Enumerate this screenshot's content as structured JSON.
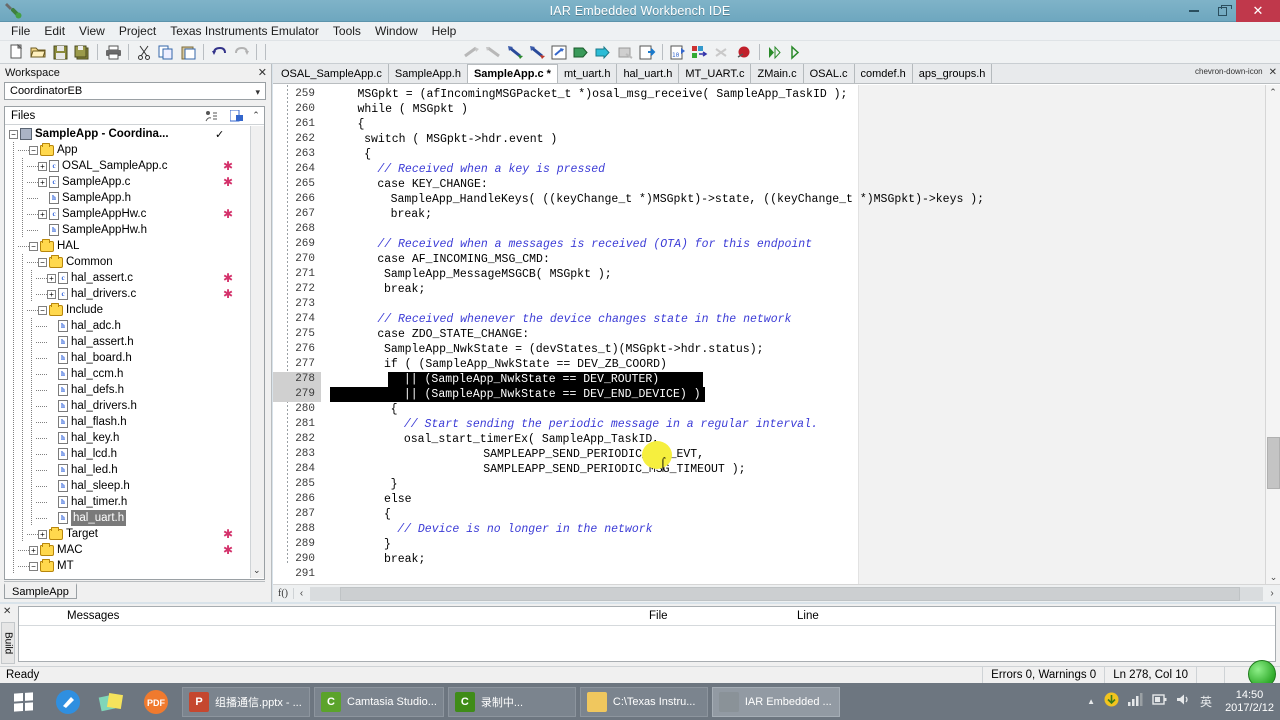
{
  "window": {
    "title": "IAR Embedded Workbench IDE",
    "app_icon": "wrench-screwdriver-icon",
    "minimize_label": "–",
    "restore_label": "❐",
    "close_label": "✕"
  },
  "menu": [
    {
      "label": "File"
    },
    {
      "label": "Edit"
    },
    {
      "label": "View"
    },
    {
      "label": "Project"
    },
    {
      "label": "Texas Instruments Emulator"
    },
    {
      "label": "Tools"
    },
    {
      "label": "Window"
    },
    {
      "label": "Help"
    }
  ],
  "toolbar": [
    {
      "name": "new-document-icon"
    },
    {
      "name": "open-folder-icon"
    },
    {
      "name": "save-icon"
    },
    {
      "name": "save-all-icon"
    },
    {
      "name": "print-icon"
    },
    {
      "name": "cut-icon"
    },
    {
      "name": "copy-icon"
    },
    {
      "name": "paste-icon"
    },
    {
      "name": "undo-icon"
    },
    {
      "name": "redo-icon"
    },
    {
      "name": "bookmark-toggle-icon"
    },
    {
      "name": "bookmark-next-icon"
    },
    {
      "name": "navigate-forward-icon"
    },
    {
      "name": "navigate-backward-icon"
    },
    {
      "name": "find-in-files-icon"
    },
    {
      "name": "compile-icon"
    },
    {
      "name": "make-icon"
    },
    {
      "name": "stop-build-icon"
    },
    {
      "name": "debug-download-icon"
    },
    {
      "name": "header-source-icon"
    },
    {
      "name": "go-to-definition-icon"
    },
    {
      "name": "toggle-breakpoints-icon"
    },
    {
      "name": "breakpoint-icon"
    },
    {
      "name": "run-icon"
    },
    {
      "name": "run-to-cursor-icon"
    }
  ],
  "workspace": {
    "panel_title": "Workspace",
    "close_label": "✕",
    "configuration": "CoordinatorEB",
    "combo_arrow": "chevron-down-icon",
    "files_header": "Files",
    "scroll_up": "⌃",
    "scroll_down": "⌄",
    "tab_label": "SampleApp",
    "tree": [
      {
        "label": "SampleApp - Coordina...",
        "depth": 0,
        "type": "project",
        "expander": "minus",
        "bold": true,
        "check": true,
        "star": false
      },
      {
        "label": "App",
        "depth": 1,
        "type": "folder",
        "expander": "minus",
        "star": false
      },
      {
        "label": "OSAL_SampleApp.c",
        "depth": 2,
        "type": "c",
        "expander": "plus",
        "star": true
      },
      {
        "label": "SampleApp.c",
        "depth": 2,
        "type": "c",
        "expander": "plus",
        "star": true
      },
      {
        "label": "SampleApp.h",
        "depth": 2,
        "type": "h",
        "expander": "none",
        "star": false
      },
      {
        "label": "SampleAppHw.c",
        "depth": 2,
        "type": "c",
        "expander": "plus",
        "star": true
      },
      {
        "label": "SampleAppHw.h",
        "depth": 2,
        "type": "h",
        "expander": "none",
        "star": false
      },
      {
        "label": "HAL",
        "depth": 1,
        "type": "folder",
        "expander": "minus",
        "star": false
      },
      {
        "label": "Common",
        "depth": 2,
        "type": "folder",
        "expander": "minus",
        "star": false
      },
      {
        "label": "hal_assert.c",
        "depth": 3,
        "type": "c",
        "expander": "plus",
        "star": true
      },
      {
        "label": "hal_drivers.c",
        "depth": 3,
        "type": "c",
        "expander": "plus",
        "star": true
      },
      {
        "label": "Include",
        "depth": 2,
        "type": "folder",
        "expander": "minus",
        "star": false
      },
      {
        "label": "hal_adc.h",
        "depth": 3,
        "type": "h",
        "expander": "none",
        "star": false
      },
      {
        "label": "hal_assert.h",
        "depth": 3,
        "type": "h",
        "expander": "none",
        "star": false
      },
      {
        "label": "hal_board.h",
        "depth": 3,
        "type": "h",
        "expander": "none",
        "star": false
      },
      {
        "label": "hal_ccm.h",
        "depth": 3,
        "type": "h",
        "expander": "none",
        "star": false
      },
      {
        "label": "hal_defs.h",
        "depth": 3,
        "type": "h",
        "expander": "none",
        "star": false
      },
      {
        "label": "hal_drivers.h",
        "depth": 3,
        "type": "h",
        "expander": "none",
        "star": false
      },
      {
        "label": "hal_flash.h",
        "depth": 3,
        "type": "h",
        "expander": "none",
        "star": false
      },
      {
        "label": "hal_key.h",
        "depth": 3,
        "type": "h",
        "expander": "none",
        "star": false
      },
      {
        "label": "hal_lcd.h",
        "depth": 3,
        "type": "h",
        "expander": "none",
        "star": false
      },
      {
        "label": "hal_led.h",
        "depth": 3,
        "type": "h",
        "expander": "none",
        "star": false
      },
      {
        "label": "hal_sleep.h",
        "depth": 3,
        "type": "h",
        "expander": "none",
        "star": false
      },
      {
        "label": "hal_timer.h",
        "depth": 3,
        "type": "h",
        "expander": "none",
        "star": false
      },
      {
        "label": "hal_uart.h",
        "depth": 3,
        "type": "h",
        "expander": "none",
        "star": false,
        "selected": true
      },
      {
        "label": "Target",
        "depth": 2,
        "type": "folder",
        "expander": "plus",
        "star": true
      },
      {
        "label": "MAC",
        "depth": 1,
        "type": "folder",
        "expander": "plus",
        "star": true
      },
      {
        "label": "MT",
        "depth": 1,
        "type": "folder",
        "expander": "minus",
        "star": false
      }
    ]
  },
  "editor": {
    "tabs": [
      {
        "label": "OSAL_SampleApp.c",
        "active": false
      },
      {
        "label": "SampleApp.h",
        "active": false
      },
      {
        "label": "SampleApp.c *",
        "active": true
      },
      {
        "label": "mt_uart.h",
        "active": false
      },
      {
        "label": "hal_uart.h",
        "active": false
      },
      {
        "label": "MT_UART.c",
        "active": false
      },
      {
        "label": "ZMain.c",
        "active": false
      },
      {
        "label": "OSAL.c",
        "active": false
      },
      {
        "label": "comdef.h",
        "active": false
      },
      {
        "label": "aps_groups.h",
        "active": false
      }
    ],
    "tab_menu_icon": "chevron-down-icon",
    "tab_close_icon": "close-icon",
    "function_label": "f()",
    "hscroll_left": "‹",
    "hscroll_right": "›",
    "vscroll_up": "⌃",
    "vscroll_down": "⌄",
    "lines": [
      {
        "no": 259,
        "indent": 4,
        "text": "MSGpkt = (afIncomingMSGPacket_t *)osal_msg_receive( SampleApp_TaskID );",
        "kind": "code"
      },
      {
        "no": 260,
        "indent": 4,
        "text": "while ( MSGpkt )",
        "kind": "code"
      },
      {
        "no": 261,
        "indent": 4,
        "text": "{",
        "kind": "code"
      },
      {
        "no": 262,
        "indent": 5,
        "text": "switch ( MSGpkt->hdr.event )",
        "kind": "code"
      },
      {
        "no": 263,
        "indent": 5,
        "text": "{",
        "kind": "code"
      },
      {
        "no": 264,
        "indent": 7,
        "text": "// Received when a key is pressed",
        "kind": "comment"
      },
      {
        "no": 265,
        "indent": 7,
        "text": "case KEY_CHANGE:",
        "kind": "code"
      },
      {
        "no": 266,
        "indent": 9,
        "text": "SampleApp_HandleKeys( ((keyChange_t *)MSGpkt)->state, ((keyChange_t *)MSGpkt)->keys );",
        "kind": "code"
      },
      {
        "no": 267,
        "indent": 9,
        "text": "break;",
        "kind": "code"
      },
      {
        "no": 268,
        "indent": 0,
        "text": "",
        "kind": "code"
      },
      {
        "no": 269,
        "indent": 7,
        "text": "// Received when a messages is received (OTA) for this endpoint",
        "kind": "comment"
      },
      {
        "no": 270,
        "indent": 7,
        "text": "case AF_INCOMING_MSG_CMD:",
        "kind": "code"
      },
      {
        "no": 271,
        "indent": 8,
        "text": "SampleApp_MessageMSGCB( MSGpkt );",
        "kind": "code"
      },
      {
        "no": 272,
        "indent": 8,
        "text": "break;",
        "kind": "code"
      },
      {
        "no": 273,
        "indent": 0,
        "text": "",
        "kind": "code"
      },
      {
        "no": 274,
        "indent": 7,
        "text": "// Received whenever the device changes state in the network",
        "kind": "comment"
      },
      {
        "no": 275,
        "indent": 7,
        "text": "case ZDO_STATE_CHANGE:",
        "kind": "code"
      },
      {
        "no": 276,
        "indent": 8,
        "text": "SampleApp_NwkState = (devStates_t)(MSGpkt->hdr.status);",
        "kind": "code"
      },
      {
        "no": 277,
        "indent": 8,
        "text": "if ( (SampleApp_NwkState == DEV_ZB_COORD)",
        "kind": "code"
      },
      {
        "no": 278,
        "indent": 11,
        "text": "|| (SampleApp_NwkState == DEV_ROUTER)",
        "kind": "selected"
      },
      {
        "no": 279,
        "indent": 11,
        "text": "|| (SampleApp_NwkState == DEV_END_DEVICE) )",
        "kind": "selected"
      },
      {
        "no": 280,
        "indent": 9,
        "text": "{",
        "kind": "code"
      },
      {
        "no": 281,
        "indent": 11,
        "text": "// Start sending the periodic message in a regular interval.",
        "kind": "comment"
      },
      {
        "no": 282,
        "indent": 11,
        "text": "osal_start_timerEx( SampleApp_TaskID,",
        "kind": "code"
      },
      {
        "no": 283,
        "indent": 23,
        "text": "SAMPLEAPP_SEND_PERIODIC_MSG_EVT,",
        "kind": "code"
      },
      {
        "no": 284,
        "indent": 23,
        "text": "SAMPLEAPP_SEND_PERIODIC_MSG_TIMEOUT );",
        "kind": "code"
      },
      {
        "no": 285,
        "indent": 9,
        "text": "}",
        "kind": "code"
      },
      {
        "no": 286,
        "indent": 8,
        "text": "else",
        "kind": "code"
      },
      {
        "no": 287,
        "indent": 8,
        "text": "{",
        "kind": "code"
      },
      {
        "no": 288,
        "indent": 10,
        "text": "// Device is no longer in the network",
        "kind": "comment"
      },
      {
        "no": 289,
        "indent": 8,
        "text": "}",
        "kind": "code"
      },
      {
        "no": 290,
        "indent": 8,
        "text": "break;",
        "kind": "code"
      },
      {
        "no": 291,
        "indent": 0,
        "text": "",
        "kind": "code"
      }
    ]
  },
  "build_panel": {
    "close_label": "✕",
    "tab_label": "Build",
    "columns": [
      {
        "label": "Messages"
      },
      {
        "label": "File"
      },
      {
        "label": "Line"
      }
    ]
  },
  "status_bar": {
    "ready": "Ready",
    "errors_warnings": "Errors 0, Warnings 0",
    "cursor_position": "Ln 278, Col 10"
  },
  "taskbar": {
    "start_label": "windows-logo",
    "quick_launch": [
      {
        "name": "blue-circle-pen-icon"
      },
      {
        "name": "sticky-notes-icon"
      },
      {
        "name": "pdf-icon",
        "label": "PDF"
      }
    ],
    "apps": [
      {
        "label": "组播通信.pptx - ...",
        "icon": "powerpoint-icon",
        "icon_letter": "P",
        "icon_color": "#c5472f",
        "active": false
      },
      {
        "label": "Camtasia Studio...",
        "icon": "camtasia-icon",
        "icon_letter": "C",
        "icon_color": "#5ba32b",
        "active": false
      },
      {
        "label": "录制中...",
        "icon": "camtasia-recorder-icon",
        "icon_letter": "C",
        "icon_color": "#3f8c18",
        "active": false
      },
      {
        "label": "C:\\Texas Instru...",
        "icon": "folder-icon",
        "icon_letter": "",
        "icon_color": "#f0c75e",
        "active": false
      },
      {
        "label": "IAR Embedded ...",
        "icon": "iar-icon",
        "icon_letter": "",
        "icon_color": "#8a9298",
        "active": true
      }
    ],
    "tray": [
      {
        "name": "show-hidden-icons-arrow",
        "glyph": "▲"
      },
      {
        "name": "update-icon",
        "glyph": "⬤"
      },
      {
        "name": "network-signal-icon",
        "glyph": "▃"
      },
      {
        "name": "battery-icon",
        "glyph": "▮"
      },
      {
        "name": "volume-icon",
        "glyph": "🔊"
      },
      {
        "name": "input-language-icon",
        "glyph": "英"
      }
    ],
    "clock_time": "14:50",
    "clock_date": "2017/2/12"
  }
}
